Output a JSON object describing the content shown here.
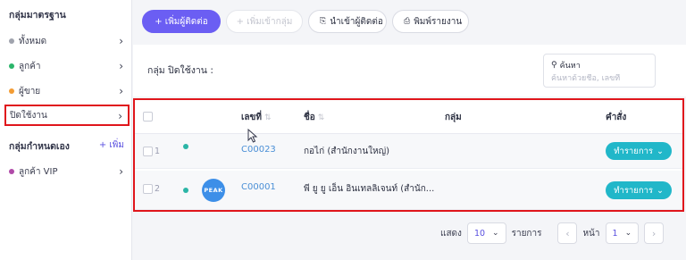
{
  "sidebar": {
    "standard_title": "กลุ่มมาตรฐาน",
    "items": [
      {
        "label": "ทั้งหมด",
        "color": "#a0a3ad"
      },
      {
        "label": "ลูกค้า",
        "color": "#2bb56a"
      },
      {
        "label": "ผู้ขาย",
        "color": "#f39c34"
      },
      {
        "label": "ปิดใช้งาน",
        "color": ""
      }
    ],
    "custom_title": "กลุ่มกำหนดเอง",
    "add_label": "+ เพิ่ม",
    "custom_items": [
      {
        "label": "ลูกค้า VIP",
        "color": "#b04aa8"
      }
    ]
  },
  "toolbar": {
    "add_contact": "+ เพิ่มผู้ติดต่อ",
    "add_to_group": "+ เพิ่มเข้ากลุ่ม",
    "import_contacts": "นำเข้าผู้ติดต่อ",
    "print_report": "พิมพ์รายงาน"
  },
  "list": {
    "title": "กลุ่ม ปิดใช้งาน :",
    "search_label": "ค้นหา",
    "search_placeholder": "ค้นหาด้วยชื่อ, เลขที่"
  },
  "table": {
    "columns": [
      "เลขที่",
      "ชื่อ",
      "กลุ่ม",
      "คำสั่ง"
    ],
    "rows": [
      {
        "num": "1",
        "code": "C00023",
        "name": "กอไก่ (สำนักงานใหญ่)",
        "action": "ทำรายการ",
        "status_color": "#2bb5a6",
        "logo": ""
      },
      {
        "num": "2",
        "code": "C00001",
        "name": "พี ยู ยู เอ็น อินเทลลิเจนท์ (สำนัก...",
        "action": "ทำรายการ",
        "status_color": "#2bb5a6",
        "logo": "PEAK"
      }
    ]
  },
  "pagination": {
    "show_label": "แสดง",
    "page_size": "10",
    "items_label": "รายการ",
    "page_label": "หน้า",
    "page": "1"
  }
}
